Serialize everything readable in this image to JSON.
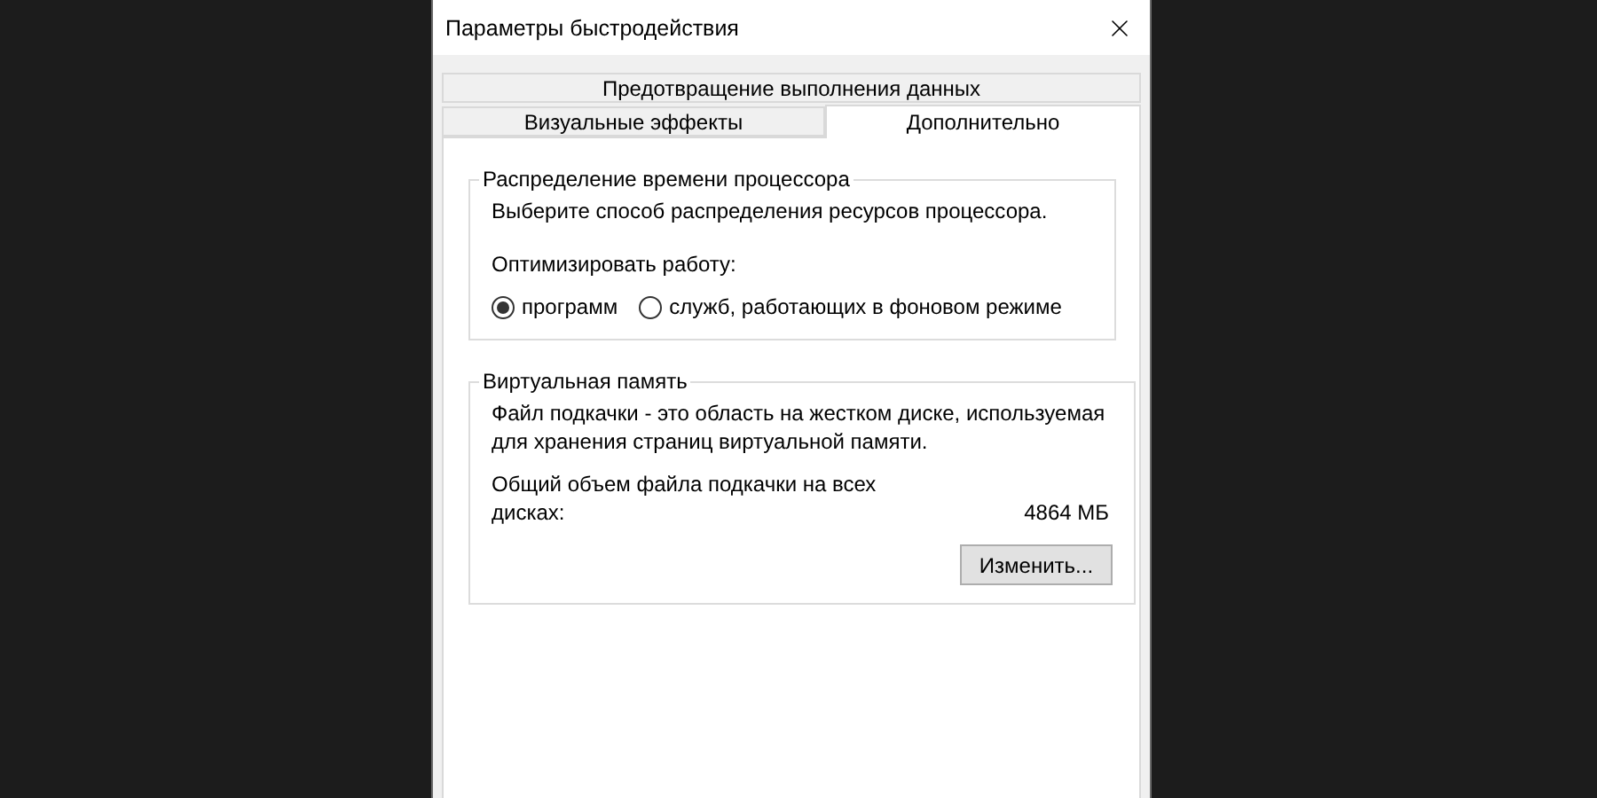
{
  "window": {
    "title": "Параметры быстродействия"
  },
  "tab_rows": [
    {
      "tabs": [
        {
          "label": "Предотвращение выполнения данных",
          "selected": false
        }
      ]
    },
    {
      "tabs": [
        {
          "label": "Визуальные эффекты",
          "selected": false
        },
        {
          "label": "Дополнительно",
          "selected": true
        }
      ]
    }
  ],
  "processor_group": {
    "title": "Распределение времени процессора",
    "description": "Выберите способ распределения ресурсов процессора.",
    "prompt": "Оптимизировать работу:",
    "options": [
      {
        "label": "программ",
        "selected": true
      },
      {
        "label": "служб, работающих в фоновом режиме",
        "selected": false
      }
    ]
  },
  "memory_group": {
    "title": "Виртуальная память",
    "description": "Файл подкачки - это область на жестком диске, используемая для хранения страниц виртуальной памяти.",
    "total_label": "Общий объем файла подкачки на всех дисках:",
    "total_value": "4864 МБ",
    "button": "Изменить..."
  }
}
